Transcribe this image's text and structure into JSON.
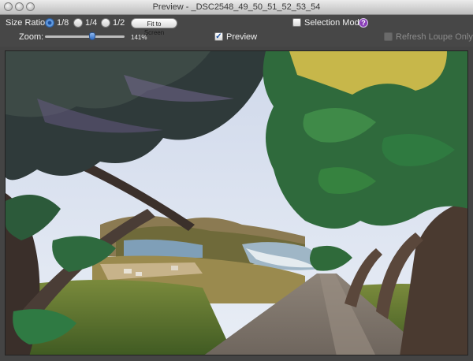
{
  "window": {
    "title": "Preview - _DSC2548_49_50_51_52_53_54"
  },
  "toolbar": {
    "size_ratio_label": "Size Ratio:",
    "ratio_options": [
      {
        "label": "1/8",
        "selected": true
      },
      {
        "label": "1/4",
        "selected": false
      },
      {
        "label": "1/2",
        "selected": false
      }
    ],
    "fit_button_label": "Fit to Screen",
    "selection_mode_label": "Selection Mode",
    "selection_mode_checked": false,
    "help_icon": "question-icon",
    "zoom_label": "Zoom:",
    "zoom_value_text": "141%",
    "zoom_slider_level": 0.6,
    "preview_label": "Preview",
    "preview_checked": true,
    "refresh_loupe_label": "Refresh Loupe Only",
    "refresh_loupe_enabled": false
  },
  "photo": {
    "description_icon": "hdr-photo-image"
  },
  "colors": {
    "window_bg": "#444444",
    "accent_radio": "#3a78c8",
    "help_badge": "#8a3fb8"
  }
}
